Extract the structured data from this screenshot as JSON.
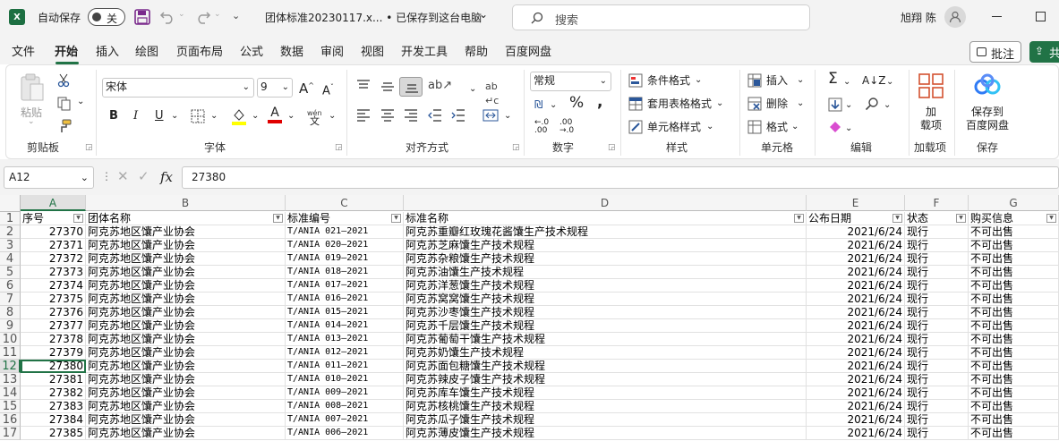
{
  "titlebar": {
    "autosave_label": "自动保存",
    "autosave_state": "关",
    "filename": "团体标准20230117.x... • 已保存到这台电脑",
    "search_placeholder": "搜索",
    "user_name": "旭翔 陈"
  },
  "tabs": [
    "文件",
    "开始",
    "插入",
    "绘图",
    "页面布局",
    "公式",
    "数据",
    "审阅",
    "视图",
    "开发工具",
    "帮助",
    "百度网盘"
  ],
  "actions": {
    "comment": "批注",
    "share": "共"
  },
  "ribbon": {
    "clipboard": {
      "paste": "粘贴",
      "label": "剪贴板"
    },
    "font": {
      "name": "宋体",
      "size": "9",
      "bold": "B",
      "italic": "I",
      "underline": "U",
      "wen": "wén",
      "label": "字体"
    },
    "align": {
      "label": "对齐方式"
    },
    "number": {
      "format": "常规",
      "label": "数字"
    },
    "styles": {
      "cond": "条件格式",
      "table": "套用表格格式",
      "cell": "单元格样式",
      "label": "样式"
    },
    "cells": {
      "insert": "插入",
      "delete": "删除",
      "format": "格式",
      "label": "单元格"
    },
    "edit": {
      "label": "编辑"
    },
    "addins": {
      "btn1": "加",
      "btn2": "载项",
      "label": "加载项"
    },
    "save": {
      "btn1": "保存到",
      "btn2": "百度网盘",
      "label": "保存"
    }
  },
  "formula_bar": {
    "name_box": "A12",
    "fx": "fx",
    "value": "27380"
  },
  "sheet": {
    "columns": [
      "A",
      "B",
      "C",
      "D",
      "E",
      "F",
      "G"
    ],
    "headers": [
      "序号",
      "团体名称",
      "标准编号",
      "标准名称",
      "公布日期",
      "状态",
      "购买信息"
    ],
    "row_numbers": [
      "1",
      "2",
      "3",
      "4",
      "5",
      "6",
      "7",
      "8",
      "9",
      "10",
      "11",
      "12",
      "13",
      "14",
      "15",
      "16",
      "17"
    ],
    "rows": [
      [
        "27370",
        "阿克苏地区馕产业协会",
        "T/ANIA 021—2021",
        "阿克苏重瓣红玫瑰花酱馕生产技术规程",
        "2021/6/24",
        "现行",
        "不可出售"
      ],
      [
        "27371",
        "阿克苏地区馕产业协会",
        "T/ANIA 020—2021",
        "阿克苏芝麻馕生产技术规程",
        "2021/6/24",
        "现行",
        "不可出售"
      ],
      [
        "27372",
        "阿克苏地区馕产业协会",
        "T/ANIA 019—2021",
        "阿克苏杂粮馕生产技术规程",
        "2021/6/24",
        "现行",
        "不可出售"
      ],
      [
        "27373",
        "阿克苏地区馕产业协会",
        "T/ANIA 018—2021",
        "阿克苏油馕生产技术规程",
        "2021/6/24",
        "现行",
        "不可出售"
      ],
      [
        "27374",
        "阿克苏地区馕产业协会",
        "T/ANIA 017—2021",
        "阿克苏洋葱馕生产技术规程",
        "2021/6/24",
        "现行",
        "不可出售"
      ],
      [
        "27375",
        "阿克苏地区馕产业协会",
        "T/ANIA 016—2021",
        "阿克苏窝窝馕生产技术规程",
        "2021/6/24",
        "现行",
        "不可出售"
      ],
      [
        "27376",
        "阿克苏地区馕产业协会",
        "T/ANIA 015—2021",
        "阿克苏沙枣馕生产技术规程",
        "2021/6/24",
        "现行",
        "不可出售"
      ],
      [
        "27377",
        "阿克苏地区馕产业协会",
        "T/ANIA 014—2021",
        "阿克苏千层馕生产技术规程",
        "2021/6/24",
        "现行",
        "不可出售"
      ],
      [
        "27378",
        "阿克苏地区馕产业协会",
        "T/ANIA 013—2021",
        "阿克苏葡萄干馕生产技术规程",
        "2021/6/24",
        "现行",
        "不可出售"
      ],
      [
        "27379",
        "阿克苏地区馕产业协会",
        "T/ANIA 012—2021",
        "阿克苏奶馕生产技术规程",
        "2021/6/24",
        "现行",
        "不可出售"
      ],
      [
        "27380",
        "阿克苏地区馕产业协会",
        "T/ANIA 011—2021",
        "阿克苏面包糖馕生产技术规程",
        "2021/6/24",
        "现行",
        "不可出售"
      ],
      [
        "27381",
        "阿克苏地区馕产业协会",
        "T/ANIA 010—2021",
        "阿克苏辣皮子馕生产技术规程",
        "2021/6/24",
        "现行",
        "不可出售"
      ],
      [
        "27382",
        "阿克苏地区馕产业协会",
        "T/ANIA 009—2021",
        "阿克苏库车馕生产技术规程",
        "2021/6/24",
        "现行",
        "不可出售"
      ],
      [
        "27383",
        "阿克苏地区馕产业协会",
        "T/ANIA 008—2021",
        "阿克苏核桃馕生产技术规程",
        "2021/6/24",
        "现行",
        "不可出售"
      ],
      [
        "27384",
        "阿克苏地区馕产业协会",
        "T/ANIA 007—2021",
        "阿克苏瓜子馕生产技术规程",
        "2021/6/24",
        "现行",
        "不可出售"
      ],
      [
        "27385",
        "阿克苏地区馕产业协会",
        "T/ANIA 006—2021",
        "阿克苏薄皮馕生产技术规程",
        "2021/6/24",
        "现行",
        "不可出售"
      ]
    ]
  }
}
